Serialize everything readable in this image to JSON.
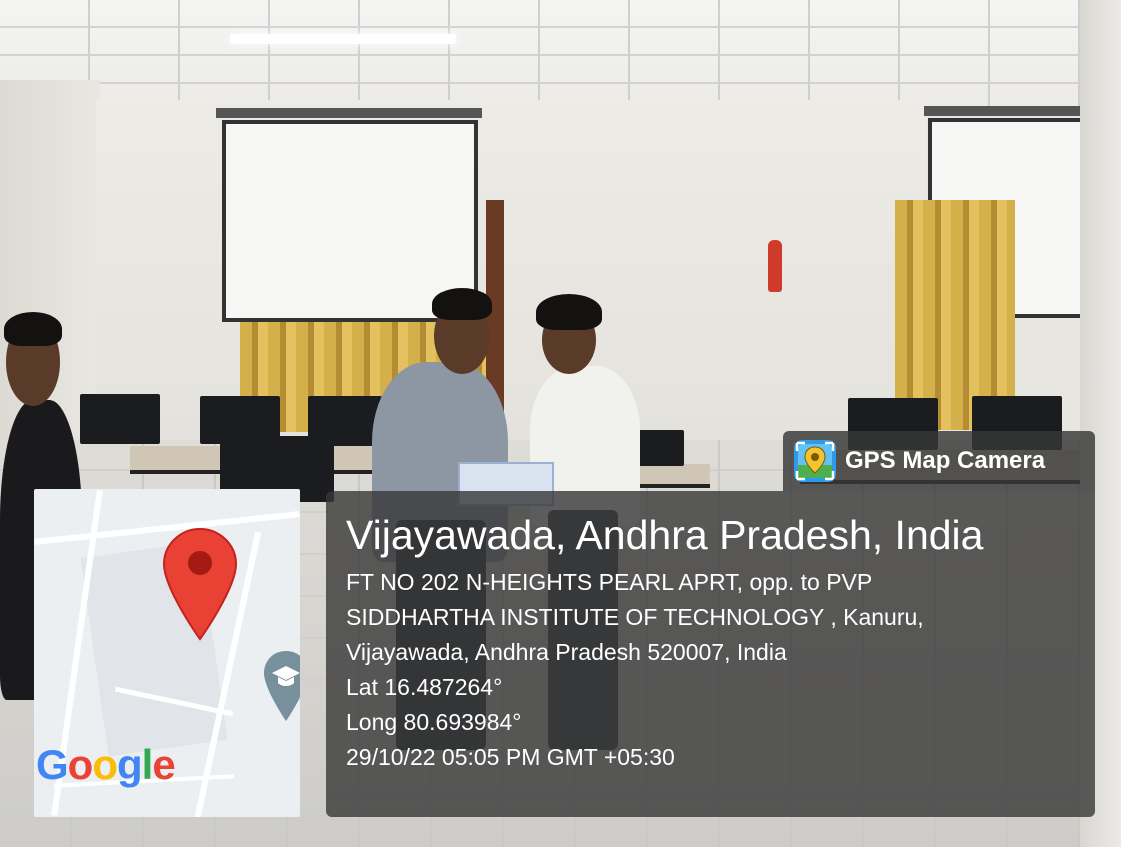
{
  "badge": {
    "icon": "gps-map-camera-app-icon",
    "title": "GPS Map Camera"
  },
  "location": {
    "city": "Vijayawada, Andhra Pradesh, India",
    "address_lines": [
      "FT NO 202 N-HEIGHTS PEARL APRT, opp. to PVP",
      "SIDDHARTHA INSTITUTE OF TECHNOLOGY , Kanuru,",
      "Vijayawada, Andhra Pradesh 520007, India"
    ],
    "latitude": "Lat 16.487264°",
    "longitude": "Long 80.693984°",
    "datetime": "29/10/22 05:05 PM GMT +05:30"
  },
  "map": {
    "logo": "Google",
    "pin_icon": "map-pin-icon",
    "poi_icon": "school-poi-icon",
    "colors": {
      "pin": "#e94235",
      "poi": "#78909c",
      "google_blue": "#4285f4",
      "google_red": "#ea4335",
      "google_yellow": "#fbbc05",
      "google_green": "#34a853"
    }
  },
  "photo": {
    "subject": "classroom-photo"
  }
}
